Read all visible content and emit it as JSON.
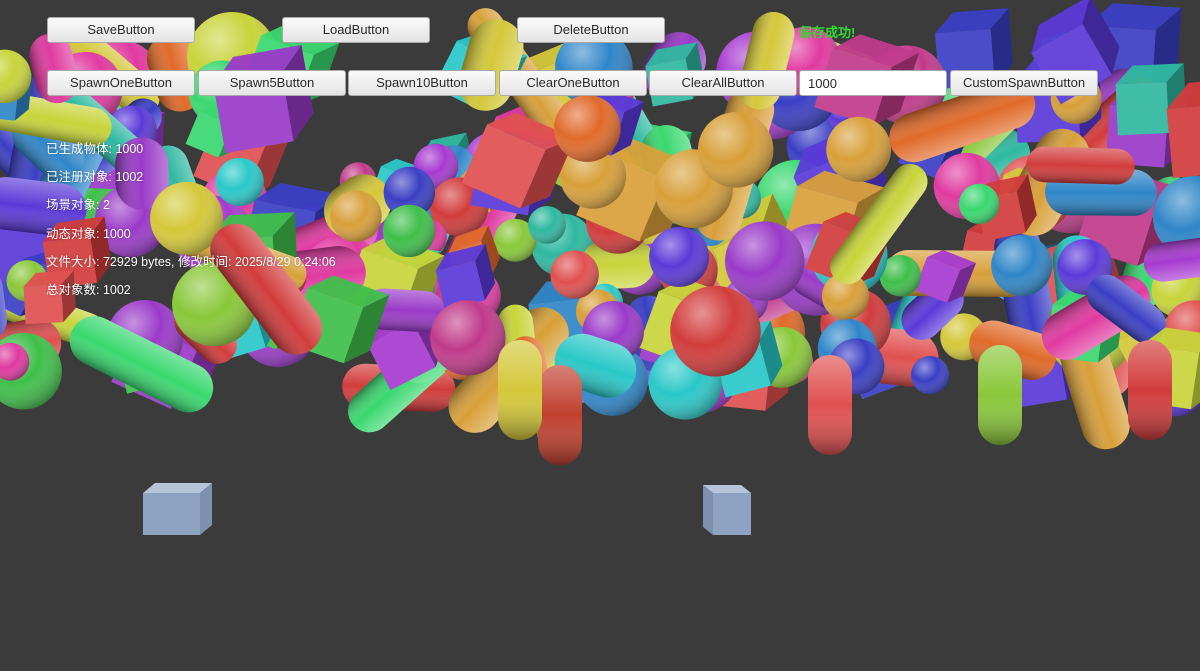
{
  "toolbar_top": {
    "save_label": "SaveButton",
    "load_label": "LoadButton",
    "delete_label": "DeleteButton",
    "status_text": "保存成功!"
  },
  "toolbar_spawn": {
    "spawn_one_label": "SpawnOneButton",
    "spawn5_label": "Spawn5Button",
    "spawn10_label": "Spawn10Button",
    "clear_one_label": "ClearOneButton",
    "clear_all_label": "ClearAllButton",
    "count_value": "1000",
    "custom_spawn_label": "CustomSpawnButton"
  },
  "stats": {
    "generated": "已生成物体: 1000",
    "registered": "已注册对象: 1002",
    "scene_objects": "场景对象: 2",
    "dynamic_objects": "动态对象: 1000",
    "file_info": "文件大小: 72929 bytes, 修改时间: 2025/8/29 0:24:06",
    "total_objects": "总对象数: 1002"
  },
  "colors": {
    "background": "#3b3b3b",
    "status_green": "#2edc2e",
    "ground_cube": "#8ea3c2"
  }
}
